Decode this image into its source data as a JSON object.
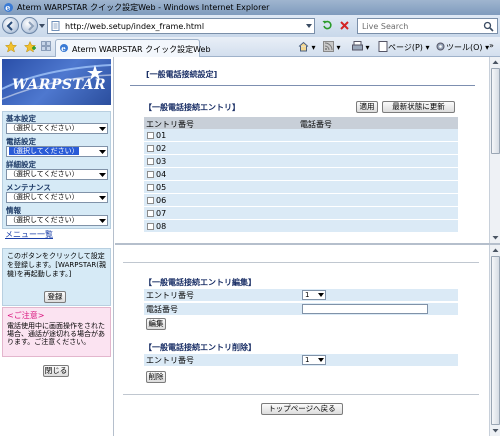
{
  "window": {
    "title": "Aterm WARPSTAR クイック設定Web - Windows Internet Explorer",
    "url": "http://web.setup/index_frame.html",
    "search_placeholder": "Live Search",
    "tab_label": "Aterm WARPSTAR クイック設定Web",
    "page_menu": "ページ(P)",
    "tools_menu": "ツール(O)"
  },
  "sidebar": {
    "logo_text": "WARPSTAR",
    "groups": [
      {
        "label": "基本設定",
        "selected": "（選択してください）",
        "active": false
      },
      {
        "label": "電話設定",
        "selected": "（選択してください）",
        "active": true
      },
      {
        "label": "詳細設定",
        "selected": "（選択してください）",
        "active": false
      },
      {
        "label": "メンテナンス",
        "selected": "（選択してください）",
        "active": false
      },
      {
        "label": "情報",
        "selected": "（選択してください）",
        "active": false
      }
    ],
    "menu_list_link": "メニュー一覧",
    "notice_text": "このボタンをクリックして設定を登録します。[WARPSTAR(親機)を再起動します。]",
    "register_button": "登録",
    "caution_title": "<ご注意>",
    "caution_text": "電話使用中に画面操作をされた場合、通話が途切れる場合があります。ご注意ください。",
    "close_button": "閉じる"
  },
  "main": {
    "page_title": "[一般電話接続設定]",
    "entry_section_title": "【一般電話接続エントリ】",
    "apply_button": "適用",
    "refresh_button": "最新状態に更新",
    "table_headers": [
      "エントリ番号",
      "電話番号"
    ],
    "entries": [
      "01",
      "02",
      "03",
      "04",
      "05",
      "06",
      "07",
      "08"
    ]
  },
  "lower": {
    "edit_section_title": "【一般電話接続エントリ編集】",
    "edit_entry_label": "エントリ番号",
    "edit_entry_value": "1",
    "edit_phone_label": "電話番号",
    "edit_phone_value": "",
    "edit_button": "編集",
    "delete_section_title": "【一般電話接続エントリ削除】",
    "delete_entry_label": "エントリ番号",
    "delete_entry_value": "1",
    "delete_button": "削除",
    "top_page_button": "トップページへ戻る"
  }
}
